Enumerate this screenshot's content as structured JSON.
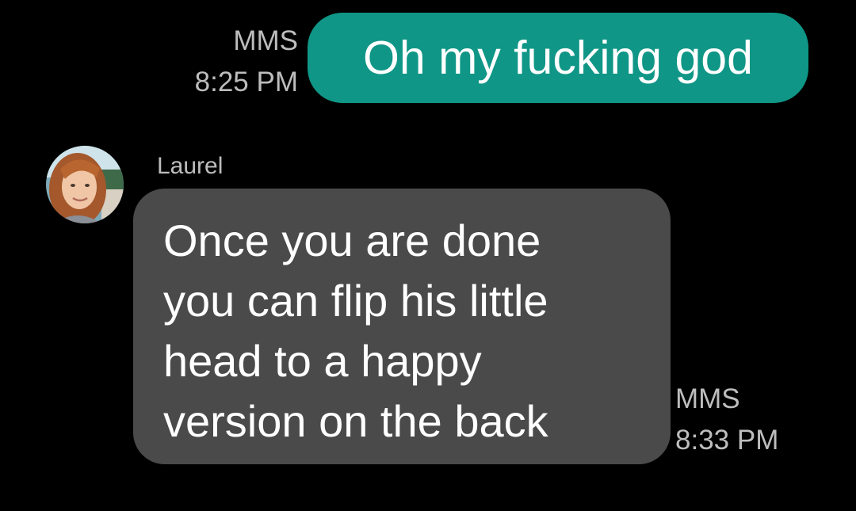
{
  "messages": [
    {
      "direction": "outgoing",
      "type_label": "MMS",
      "time": "8:25 PM",
      "text": "Oh my fucking god",
      "bubble_color": "#0f9686"
    },
    {
      "direction": "incoming",
      "sender": "Laurel",
      "avatar_icon": "contact-photo-avatar",
      "lines": [
        "Once you are done",
        "you can flip his little",
        "head to a happy",
        "version on the back"
      ],
      "type_label": "MMS",
      "time": "8:33 PM",
      "bubble_color": "#4a4a4a"
    }
  ],
  "colors": {
    "background": "#000000",
    "meta_text": "#bdbdbd",
    "message_text": "#ffffff"
  }
}
